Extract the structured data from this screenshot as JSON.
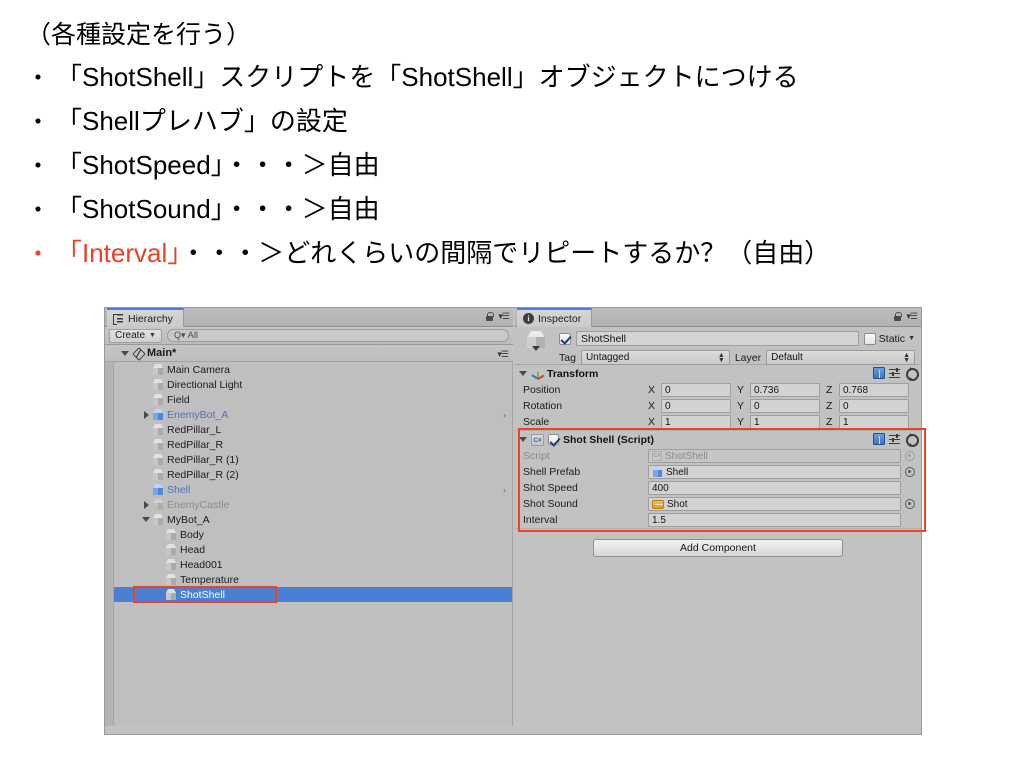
{
  "slide": {
    "heading": "（各種設定を行う）",
    "bullets": [
      {
        "marker": "・",
        "text": "「ShotShell」スクリプトを「ShotShell」オブジェクトにつける",
        "accent": false
      },
      {
        "marker": "・",
        "text": "「Shellプレハブ」の設定",
        "accent": false
      },
      {
        "marker": "・",
        "text": "「ShotSpeed」・・・＞自由",
        "accent": false
      },
      {
        "marker": "・",
        "text": "「ShotSound」・・・＞自由",
        "accent": false
      },
      {
        "marker": "・",
        "accent": true,
        "accent_text": "「Interval」",
        "rest_text": "・・・＞どれくらいの間隔でリピートするか？（自由）"
      }
    ],
    "accent_color": "#ea4123"
  },
  "editor": {
    "hierarchy": {
      "tab_label": "Hierarchy",
      "create_label": "Create",
      "search_placeholder": "All",
      "scene_name": "Main*",
      "items": [
        {
          "label": "Main Camera",
          "depth": 2,
          "style": "normal",
          "twisty": "none",
          "chevron": false
        },
        {
          "label": "Directional Light",
          "depth": 2,
          "style": "normal",
          "twisty": "none",
          "chevron": false
        },
        {
          "label": "Field",
          "depth": 2,
          "style": "normal",
          "twisty": "none",
          "chevron": false
        },
        {
          "label": "EnemyBot_A",
          "depth": 2,
          "style": "prefab",
          "twisty": "right",
          "chevron": true
        },
        {
          "label": "RedPillar_L",
          "depth": 2,
          "style": "normal",
          "twisty": "none",
          "chevron": false
        },
        {
          "label": "RedPillar_R",
          "depth": 2,
          "style": "normal",
          "twisty": "none",
          "chevron": false
        },
        {
          "label": "RedPillar_R (1)",
          "depth": 2,
          "style": "normal",
          "twisty": "none",
          "chevron": false
        },
        {
          "label": "RedPillar_R (2)",
          "depth": 2,
          "style": "normal",
          "twisty": "none",
          "chevron": false
        },
        {
          "label": "Shell",
          "depth": 2,
          "style": "prefab",
          "twisty": "none",
          "chevron": true
        },
        {
          "label": "EnemyCastle",
          "depth": 2,
          "style": "dim",
          "twisty": "right",
          "chevron": false
        },
        {
          "label": "MyBot_A",
          "depth": 2,
          "style": "normal",
          "twisty": "down",
          "chevron": false
        },
        {
          "label": "Body",
          "depth": 3,
          "style": "normal",
          "twisty": "none",
          "chevron": false
        },
        {
          "label": "Head",
          "depth": 3,
          "style": "normal",
          "twisty": "none",
          "chevron": false
        },
        {
          "label": "Head001",
          "depth": 3,
          "style": "normal",
          "twisty": "none",
          "chevron": false
        },
        {
          "label": "Temperature",
          "depth": 3,
          "style": "normal",
          "twisty": "none",
          "chevron": false
        },
        {
          "label": "ShotShell",
          "depth": 3,
          "style": "selected",
          "twisty": "none",
          "chevron": false
        }
      ]
    },
    "inspector": {
      "tab_label": "Inspector",
      "object_name": "ShotShell",
      "object_enabled": true,
      "static_label": "Static",
      "static_checked": false,
      "tag_label": "Tag",
      "tag_value": "Untagged",
      "layer_label": "Layer",
      "layer_value": "Default",
      "transform": {
        "title": "Transform",
        "rows": [
          {
            "label": "Position",
            "x": "0",
            "y": "0.736",
            "z": "0.768"
          },
          {
            "label": "Rotation",
            "x": "0",
            "y": "0",
            "z": "0"
          },
          {
            "label": "Scale",
            "x": "1",
            "y": "1",
            "z": "1"
          }
        ],
        "axis_labels": {
          "x": "X",
          "y": "Y",
          "z": "Z"
        }
      },
      "script_component": {
        "title": "Shot Shell (Script)",
        "enabled": true,
        "badge": "C#",
        "fields": [
          {
            "label": "Script",
            "value": "ShotShell",
            "kind": "script-ref"
          },
          {
            "label": "Shell Prefab",
            "value": "Shell",
            "kind": "object-ref"
          },
          {
            "label": "Shot Speed",
            "value": "400",
            "kind": "number"
          },
          {
            "label": "Shot Sound",
            "value": "Shot",
            "kind": "audio-ref"
          },
          {
            "label": "Interval",
            "value": "1.5",
            "kind": "number"
          }
        ]
      },
      "add_component_label": "Add Component"
    },
    "annotation_color": "#ef4123"
  }
}
